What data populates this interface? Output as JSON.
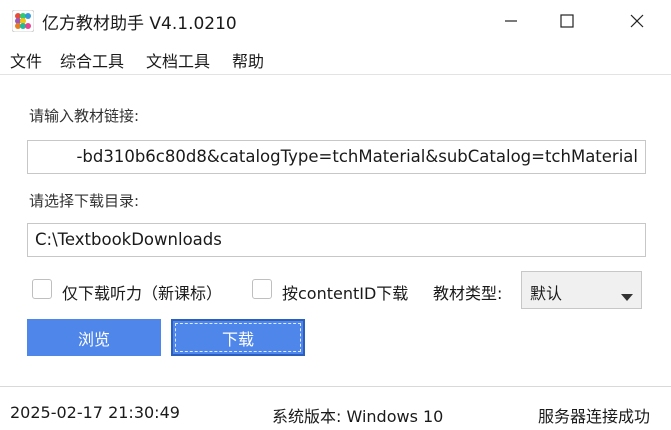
{
  "window": {
    "title": "亿方教材助手 V4.1.0210",
    "app_icon": "app-grid-icon",
    "controls": [
      "minimize-icon",
      "maximize-icon",
      "close-icon"
    ]
  },
  "menu": {
    "items": [
      {
        "label": "文件"
      },
      {
        "label": "综合工具"
      },
      {
        "label": "文档工具"
      },
      {
        "label": "帮助"
      }
    ]
  },
  "form": {
    "link_label": "请输入教材链接:",
    "link_value": "-bd310b6c80d8&catalogType=tchMaterial&subCatalog=tchMaterial",
    "dir_label": "请选择下载目录:",
    "dir_value": "C:\\TextbookDownloads",
    "checkbox_listening": {
      "label": "仅下载听力（新课标）",
      "checked": false
    },
    "checkbox_contentid": {
      "label": "按contentID下载",
      "checked": false
    },
    "type_label": "教材类型:",
    "type_value": "默认",
    "browse_label": "浏览",
    "download_label": "下载"
  },
  "status": {
    "datetime": "2025-02-17 21:30:49",
    "os_version": "系统版本: Windows 10",
    "server": "服务器连接成功"
  },
  "colors": {
    "button_primary": "#4f86ea",
    "button_focus_border": "#2b5fbf"
  }
}
